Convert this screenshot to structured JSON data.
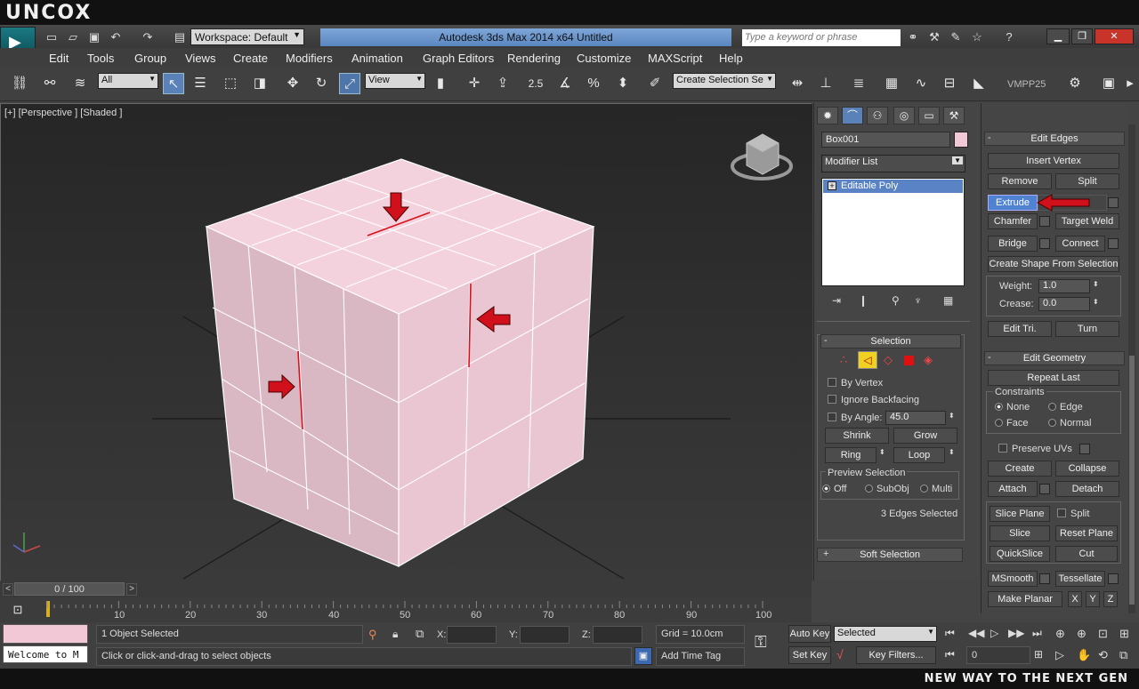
{
  "brand": {
    "logo": "UNCOX",
    "tagline": "NEW WAY TO THE NEXT GEN"
  },
  "titlebar": {
    "workspace": "Workspace: Default",
    "app_title": "Autodesk 3ds Max  2014 x64      Untitled",
    "search_placeholder": "Type a keyword or phrase"
  },
  "menu": [
    "Edit",
    "Tools",
    "Group",
    "Views",
    "Create",
    "Modifiers",
    "Animation",
    "Graph Editors",
    "Rendering",
    "Customize",
    "MAXScript",
    "Help"
  ],
  "toolbar": {
    "filter": "All",
    "ref_coord": "View",
    "snap_angle": "2.5",
    "selection_set_placeholder": "Create Selection Se",
    "plugin_label": "VMPP25"
  },
  "viewport": {
    "label": "[+] [Perspective ] [Shaded ]"
  },
  "timeline": {
    "frame": "0 / 100",
    "ticks": [
      "10",
      "20",
      "30",
      "40",
      "50",
      "60",
      "70",
      "80",
      "90",
      "100"
    ]
  },
  "status": {
    "maxscript_text": "Welcome to M",
    "selected_info": "1 Object Selected",
    "prompt": "Click or click-and-drag to select objects",
    "x_label": "X:",
    "y_label": "Y:",
    "z_label": "Z:",
    "grid": "Grid = 10.0cm",
    "add_time_tag": "Add Time Tag",
    "auto_key": "Auto Key",
    "set_key": "Set Key",
    "key_mode": "Selected",
    "key_filters": "Key Filters...",
    "current_frame": "0"
  },
  "command_panel": {
    "object_name": "Box001",
    "modifier_list": "Modifier List",
    "stack_item": "Editable Poly",
    "selection": {
      "title": "Selection",
      "by_vertex": "By Vertex",
      "ignore_backfacing": "Ignore Backfacing",
      "by_angle": "By Angle:",
      "angle_value": "45.0",
      "shrink": "Shrink",
      "grow": "Grow",
      "ring": "Ring",
      "loop": "Loop",
      "preview_title": "Preview Selection",
      "preview_off": "Off",
      "preview_subobj": "SubObj",
      "preview_multi": "Multi",
      "count": "3 Edges Selected"
    },
    "soft_selection": "Soft Selection"
  },
  "edit_edges": {
    "title": "Edit Edges",
    "insert_vertex": "Insert Vertex",
    "remove": "Remove",
    "split": "Split",
    "extrude": "Extrude",
    "chamfer": "Chamfer",
    "target_weld": "Target Weld",
    "bridge": "Bridge",
    "connect": "Connect",
    "create_shape": "Create Shape From Selection",
    "weight_label": "Weight:",
    "weight_value": "1.0",
    "crease_label": "Crease:",
    "crease_value": "0.0",
    "edit_tri": "Edit Tri.",
    "turn": "Turn"
  },
  "edit_geometry": {
    "title": "Edit Geometry",
    "repeat_last": "Repeat Last",
    "constraints": "Constraints",
    "none": "None",
    "edge": "Edge",
    "face": "Face",
    "normal": "Normal",
    "preserve_uvs": "Preserve UVs",
    "create": "Create",
    "collapse": "Collapse",
    "attach": "Attach",
    "detach": "Detach",
    "slice_plane": "Slice Plane",
    "split": "Split",
    "slice": "Slice",
    "reset_plane": "Reset Plane",
    "quickslice": "QuickSlice",
    "cut": "Cut",
    "msmooth": "MSmooth",
    "tessellate": "Tessellate",
    "make_planar": "Make Planar",
    "x": "X",
    "y": "Y",
    "z": "Z"
  },
  "colors": {
    "object_color": "#f2c8d6",
    "selection_blue": "#4f83d1",
    "arrow_red": "#d0101a"
  }
}
